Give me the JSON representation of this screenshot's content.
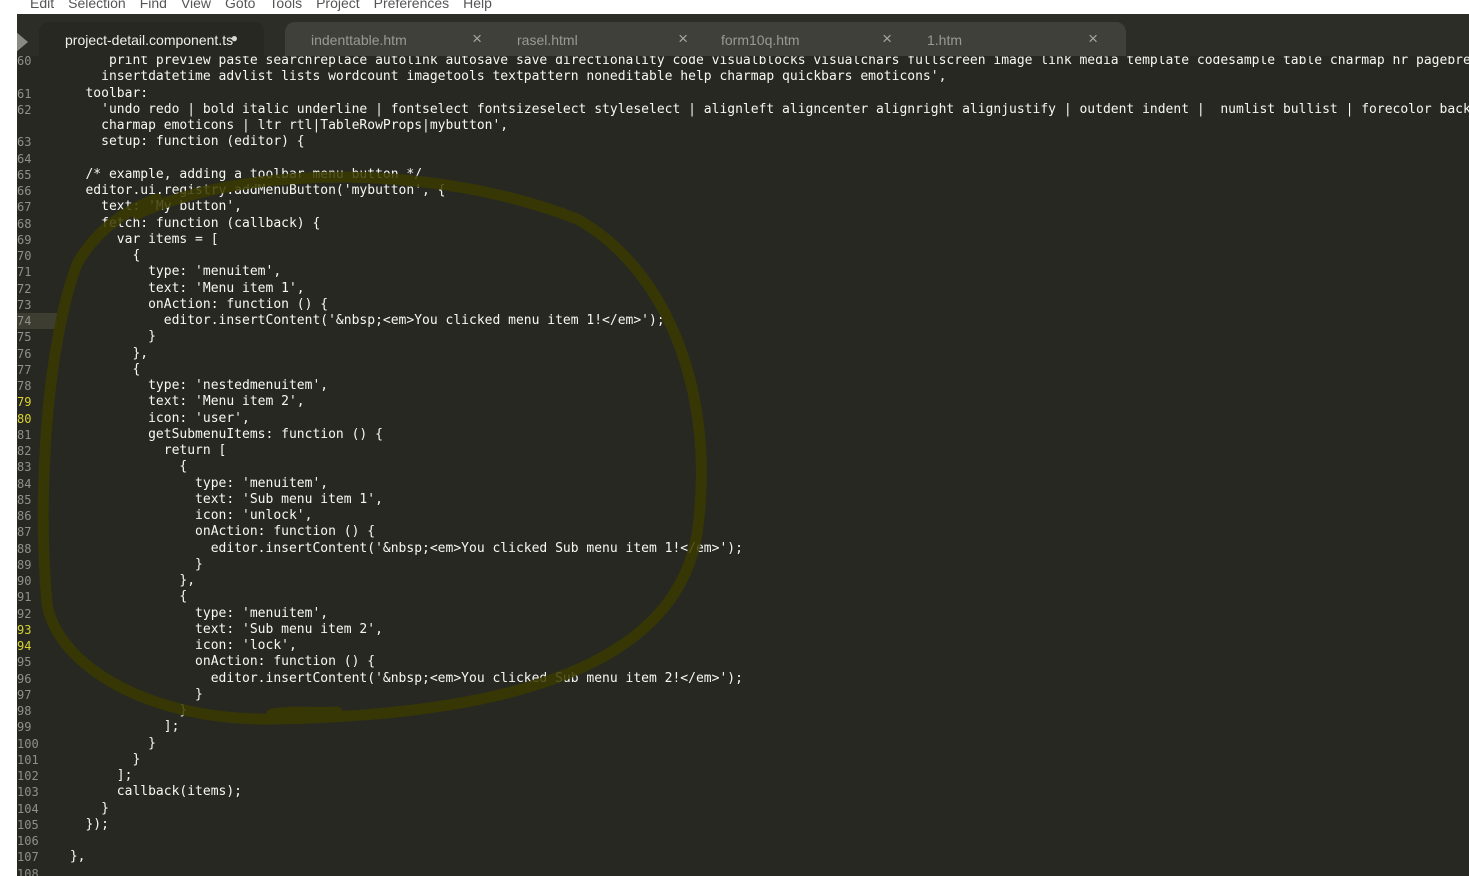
{
  "menu": [
    "Edit",
    "Selection",
    "Find",
    "View",
    "Goto",
    "Tools",
    "Project",
    "Preferences",
    "Help"
  ],
  "tabs": [
    {
      "label": "project-detail.component.ts",
      "active": true,
      "modified": true
    },
    {
      "label": "indenttable.htm",
      "active": false,
      "modified": false
    },
    {
      "label": "rasel.html",
      "active": false,
      "modified": false
    },
    {
      "label": "form10q.htm",
      "active": false,
      "modified": false
    },
    {
      "label": "1.htm",
      "active": false,
      "modified": false
    }
  ],
  "tab_icons": {
    "close": "close-icon",
    "modified": "modified-dot-icon"
  },
  "colors": {
    "editor_bg": "#272822",
    "text": "#f8f8f2",
    "highlight_yellow": "#e6db74",
    "annotation": "#3a3a00"
  },
  "lines": [
    {
      "n": "60",
      "text": "      print preview paste searchreplace autolink autosave save directionality code visualblocks visualchars fullscreen image link media template codesample table charmap hr pagebreak no"
    },
    {
      "n": "",
      "text": "     insertdatetime advlist lists wordcount imagetools textpattern noneditable help charmap quickbars emoticons',"
    },
    {
      "n": "61",
      "text": "   toolbar:"
    },
    {
      "n": "62",
      "text": "     'undo redo | bold italic underline | fontselect fontsizeselect styleselect | alignleft aligncenter alignright alignjustify | outdent indent |  numlist bullist | forecolor backcolor"
    },
    {
      "n": "",
      "text": "     charmap emoticons | ltr rtl|TableRowProps|mybutton',"
    },
    {
      "n": "63",
      "text": "     setup: function (editor) {"
    },
    {
      "n": "64",
      "text": ""
    },
    {
      "n": "65",
      "text": "   /* example, adding a toolbar menu button */"
    },
    {
      "n": "66",
      "text": "   editor.ui.registry.addMenuButton('mybutton', {"
    },
    {
      "n": "67",
      "text": "     text: 'My button',"
    },
    {
      "n": "68",
      "text": "     fetch: function (callback) {"
    },
    {
      "n": "69",
      "text": "       var items = ["
    },
    {
      "n": "70",
      "text": "         {"
    },
    {
      "n": "71",
      "text": "           type: 'menuitem',"
    },
    {
      "n": "72",
      "text": "           text: 'Menu item 1',"
    },
    {
      "n": "73",
      "text": "           onAction: function () {"
    },
    {
      "n": "74",
      "text": "             editor.insertContent('&nbsp;<em>You clicked menu item 1!</em>');"
    },
    {
      "n": "75",
      "text": "           }"
    },
    {
      "n": "76",
      "text": "         },"
    },
    {
      "n": "77",
      "text": "         {"
    },
    {
      "n": "78",
      "text": "           type: 'nestedmenuitem',"
    },
    {
      "n": "79",
      "text": "           text: 'Menu item 2',"
    },
    {
      "n": "80",
      "text": "           icon: 'user',"
    },
    {
      "n": "81",
      "text": "           getSubmenuItems: function () {"
    },
    {
      "n": "82",
      "text": "             return ["
    },
    {
      "n": "83",
      "text": "               {"
    },
    {
      "n": "84",
      "text": "                 type: 'menuitem',"
    },
    {
      "n": "85",
      "text": "                 text: 'Sub menu item 1',"
    },
    {
      "n": "86",
      "text": "                 icon: 'unlock',"
    },
    {
      "n": "87",
      "text": "                 onAction: function () {"
    },
    {
      "n": "88",
      "text": "                   editor.insertContent('&nbsp;<em>You clicked Sub menu item 1!</em>');"
    },
    {
      "n": "89",
      "text": "                 }"
    },
    {
      "n": "90",
      "text": "               },"
    },
    {
      "n": "91",
      "text": "               {"
    },
    {
      "n": "92",
      "text": "                 type: 'menuitem',"
    },
    {
      "n": "93",
      "text": "                 text: 'Sub menu item 2',"
    },
    {
      "n": "94",
      "text": "                 icon: 'lock',"
    },
    {
      "n": "95",
      "text": "                 onAction: function () {"
    },
    {
      "n": "96",
      "text": "                   editor.insertContent('&nbsp;<em>You clicked Sub menu item 2!</em>');"
    },
    {
      "n": "97",
      "text": "                 }"
    },
    {
      "n": "98",
      "text": "               }"
    },
    {
      "n": "99",
      "text": "             ];"
    },
    {
      "n": "100",
      "text": "           }"
    },
    {
      "n": "101",
      "text": "         }"
    },
    {
      "n": "102",
      "text": "       ];"
    },
    {
      "n": "103",
      "text": "       callback(items);"
    },
    {
      "n": "104",
      "text": "     }"
    },
    {
      "n": "105",
      "text": "   });"
    },
    {
      "n": "106",
      "text": ""
    },
    {
      "n": "107",
      "text": " },"
    },
    {
      "n": "108",
      "text": ""
    }
  ]
}
